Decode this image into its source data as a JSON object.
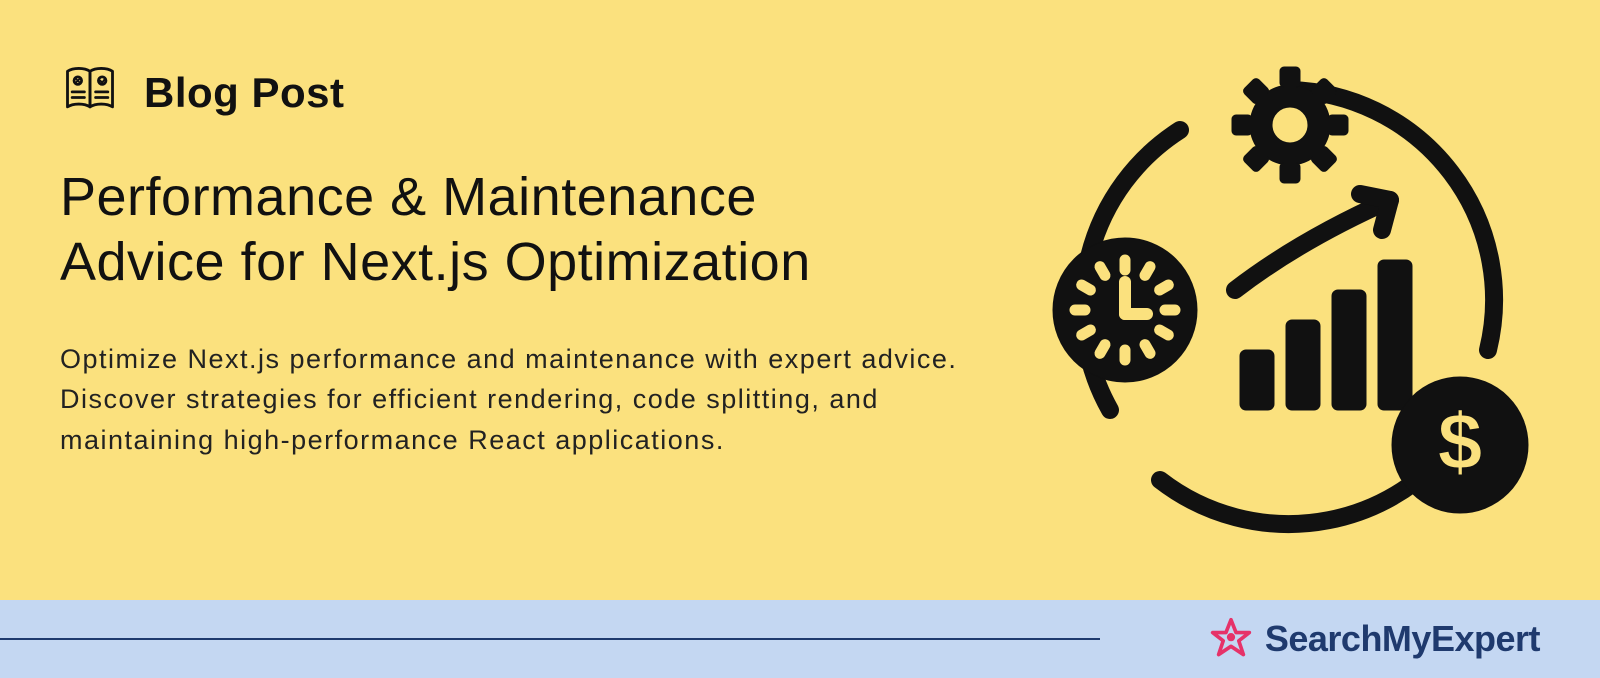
{
  "badge": {
    "label": "Blog Post"
  },
  "title_line1": "Performance & Maintenance",
  "title_line2": "Advice for Next.js Optimization",
  "description": "Optimize Next.js performance and maintenance with expert advice. Discover strategies for efficient rendering, code splitting, and maintaining high-performance React applications.",
  "brand": {
    "name": "SearchMyExpert"
  },
  "colors": {
    "background": "#fbe17e",
    "footer": "#c4d7f2",
    "brand_primary": "#1f3a6e",
    "brand_accent": "#e63269",
    "text": "#111111"
  }
}
